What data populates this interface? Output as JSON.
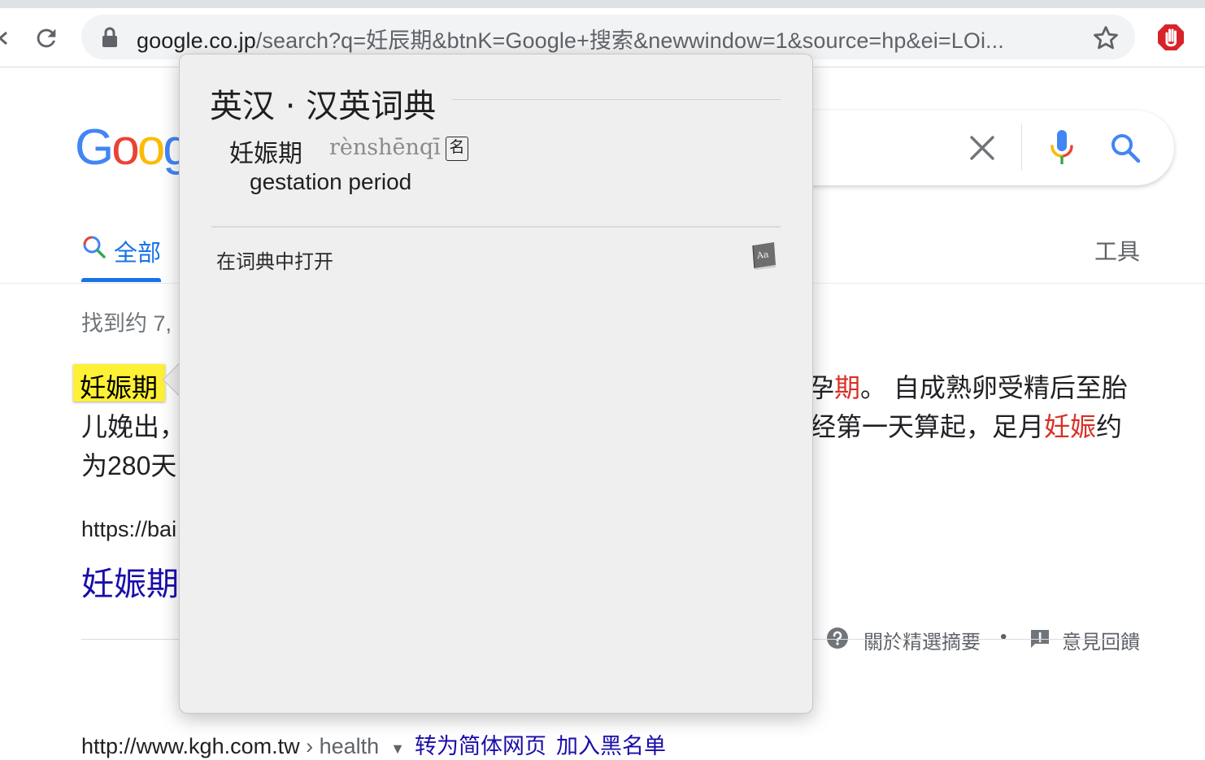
{
  "browser": {
    "url_host": "google.co.jp",
    "url_rest": "/search?q=妊辰期&btnK=Google+搜索&newwindow=1&source=hp&ei=LOi...",
    "icons": [
      "back-icon",
      "reload-icon",
      "lock-icon",
      "star-icon",
      "stop-hand-icon"
    ]
  },
  "google": {
    "logo_letters": [
      "G",
      "o",
      "o",
      "g"
    ],
    "logo_colors": [
      "#4285f4",
      "#ea4335",
      "#fbbc05",
      "#4285f4"
    ],
    "tab_all": "全部",
    "tools": "工具",
    "result_count": "找到约 7,",
    "snippet": {
      "highlight_word": "妊娠期",
      "line1_right_a": "孕",
      "line1_right_b": "期",
      "line1_right_c": "。 自成熟卵受精后至胎",
      "line2_left": "儿娩出，",
      "line2_right_a": "经第一天算起，足月",
      "line2_right_b": "妊娠",
      "line2_right_c": "约",
      "line3_left": "为280天"
    },
    "cite1": "https://bai",
    "result_title": "妊娠期",
    "about_snippets": "關於精選摘要",
    "separator": "•",
    "feedback": "意見回饋",
    "cite2": {
      "url": "http://www.kgh.com.tw",
      "path": " › health",
      "translate": "转为简体网页",
      "blocklist": "加入黑名单"
    }
  },
  "dictionary_popover": {
    "title": "英汉 · 汉英词典",
    "headword": "妊娠期",
    "pinyin": "rènshēnqī",
    "part_of_speech": "名",
    "gloss": "gestation period",
    "open_in_dictionary": "在词典中打开",
    "book_icon_text": "Aa"
  }
}
